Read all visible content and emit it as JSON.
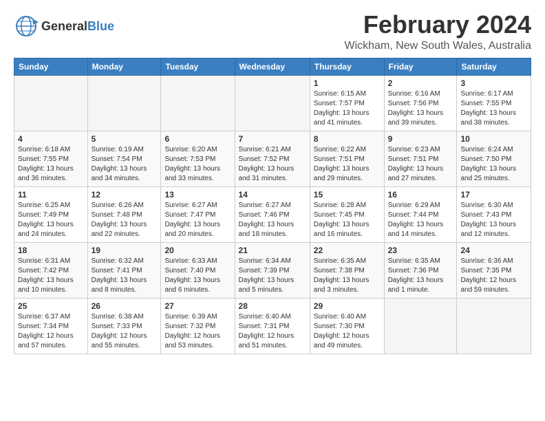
{
  "logo": {
    "general": "General",
    "blue": "Blue"
  },
  "title": "February 2024",
  "location": "Wickham, New South Wales, Australia",
  "days_header": [
    "Sunday",
    "Monday",
    "Tuesday",
    "Wednesday",
    "Thursday",
    "Friday",
    "Saturday"
  ],
  "weeks": [
    [
      {
        "day": "",
        "info": ""
      },
      {
        "day": "",
        "info": ""
      },
      {
        "day": "",
        "info": ""
      },
      {
        "day": "",
        "info": ""
      },
      {
        "day": "1",
        "info": "Sunrise: 6:15 AM\nSunset: 7:57 PM\nDaylight: 13 hours\nand 41 minutes."
      },
      {
        "day": "2",
        "info": "Sunrise: 6:16 AM\nSunset: 7:56 PM\nDaylight: 13 hours\nand 39 minutes."
      },
      {
        "day": "3",
        "info": "Sunrise: 6:17 AM\nSunset: 7:55 PM\nDaylight: 13 hours\nand 38 minutes."
      }
    ],
    [
      {
        "day": "4",
        "info": "Sunrise: 6:18 AM\nSunset: 7:55 PM\nDaylight: 13 hours\nand 36 minutes."
      },
      {
        "day": "5",
        "info": "Sunrise: 6:19 AM\nSunset: 7:54 PM\nDaylight: 13 hours\nand 34 minutes."
      },
      {
        "day": "6",
        "info": "Sunrise: 6:20 AM\nSunset: 7:53 PM\nDaylight: 13 hours\nand 33 minutes."
      },
      {
        "day": "7",
        "info": "Sunrise: 6:21 AM\nSunset: 7:52 PM\nDaylight: 13 hours\nand 31 minutes."
      },
      {
        "day": "8",
        "info": "Sunrise: 6:22 AM\nSunset: 7:51 PM\nDaylight: 13 hours\nand 29 minutes."
      },
      {
        "day": "9",
        "info": "Sunrise: 6:23 AM\nSunset: 7:51 PM\nDaylight: 13 hours\nand 27 minutes."
      },
      {
        "day": "10",
        "info": "Sunrise: 6:24 AM\nSunset: 7:50 PM\nDaylight: 13 hours\nand 25 minutes."
      }
    ],
    [
      {
        "day": "11",
        "info": "Sunrise: 6:25 AM\nSunset: 7:49 PM\nDaylight: 13 hours\nand 24 minutes."
      },
      {
        "day": "12",
        "info": "Sunrise: 6:26 AM\nSunset: 7:48 PM\nDaylight: 13 hours\nand 22 minutes."
      },
      {
        "day": "13",
        "info": "Sunrise: 6:27 AM\nSunset: 7:47 PM\nDaylight: 13 hours\nand 20 minutes."
      },
      {
        "day": "14",
        "info": "Sunrise: 6:27 AM\nSunset: 7:46 PM\nDaylight: 13 hours\nand 18 minutes."
      },
      {
        "day": "15",
        "info": "Sunrise: 6:28 AM\nSunset: 7:45 PM\nDaylight: 13 hours\nand 16 minutes."
      },
      {
        "day": "16",
        "info": "Sunrise: 6:29 AM\nSunset: 7:44 PM\nDaylight: 13 hours\nand 14 minutes."
      },
      {
        "day": "17",
        "info": "Sunrise: 6:30 AM\nSunset: 7:43 PM\nDaylight: 13 hours\nand 12 minutes."
      }
    ],
    [
      {
        "day": "18",
        "info": "Sunrise: 6:31 AM\nSunset: 7:42 PM\nDaylight: 13 hours\nand 10 minutes."
      },
      {
        "day": "19",
        "info": "Sunrise: 6:32 AM\nSunset: 7:41 PM\nDaylight: 13 hours\nand 8 minutes."
      },
      {
        "day": "20",
        "info": "Sunrise: 6:33 AM\nSunset: 7:40 PM\nDaylight: 13 hours\nand 6 minutes."
      },
      {
        "day": "21",
        "info": "Sunrise: 6:34 AM\nSunset: 7:39 PM\nDaylight: 13 hours\nand 5 minutes."
      },
      {
        "day": "22",
        "info": "Sunrise: 6:35 AM\nSunset: 7:38 PM\nDaylight: 13 hours\nand 3 minutes."
      },
      {
        "day": "23",
        "info": "Sunrise: 6:35 AM\nSunset: 7:36 PM\nDaylight: 13 hours\nand 1 minute."
      },
      {
        "day": "24",
        "info": "Sunrise: 6:36 AM\nSunset: 7:35 PM\nDaylight: 12 hours\nand 59 minutes."
      }
    ],
    [
      {
        "day": "25",
        "info": "Sunrise: 6:37 AM\nSunset: 7:34 PM\nDaylight: 12 hours\nand 57 minutes."
      },
      {
        "day": "26",
        "info": "Sunrise: 6:38 AM\nSunset: 7:33 PM\nDaylight: 12 hours\nand 55 minutes."
      },
      {
        "day": "27",
        "info": "Sunrise: 6:39 AM\nSunset: 7:32 PM\nDaylight: 12 hours\nand 53 minutes."
      },
      {
        "day": "28",
        "info": "Sunrise: 6:40 AM\nSunset: 7:31 PM\nDaylight: 12 hours\nand 51 minutes."
      },
      {
        "day": "29",
        "info": "Sunrise: 6:40 AM\nSunset: 7:30 PM\nDaylight: 12 hours\nand 49 minutes."
      },
      {
        "day": "",
        "info": ""
      },
      {
        "day": "",
        "info": ""
      }
    ]
  ]
}
